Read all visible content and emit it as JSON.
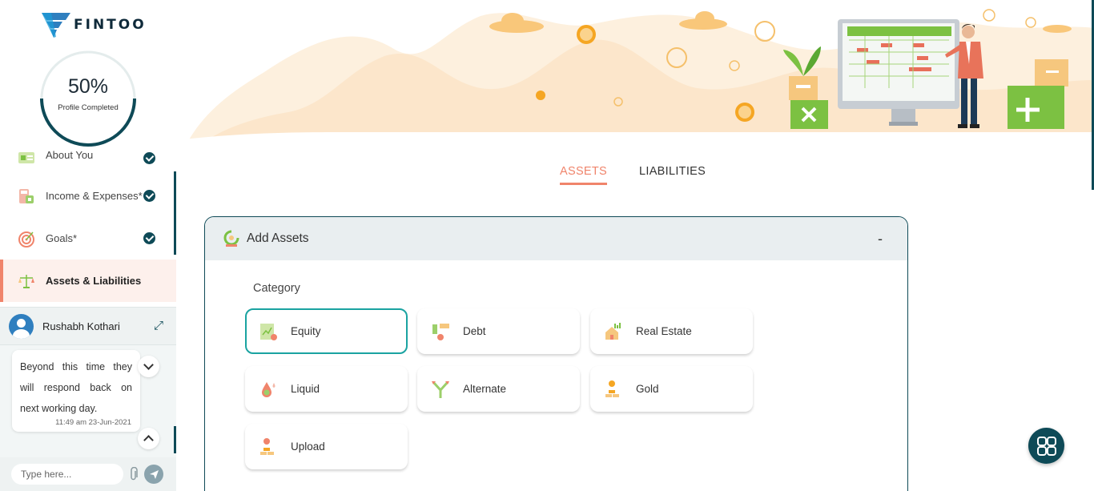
{
  "brand": {
    "name": "FINTOO"
  },
  "profile": {
    "percent": "50%",
    "label": "Profile Completed"
  },
  "nav": {
    "items": [
      {
        "label": "About You",
        "completed": true
      },
      {
        "label": "Income & Expenses*",
        "completed": true
      },
      {
        "label": "Goals*",
        "completed": true
      },
      {
        "label": "Assets & Liabilities",
        "active": true
      }
    ]
  },
  "chat": {
    "agent_name": "Rushabh Kothari",
    "message": "Beyond this time they will respond back on next working day.",
    "timestamp": "11:49 am 23-Jun-2021",
    "input_placeholder": "Type here..."
  },
  "tabs": [
    {
      "label": "ASSETS",
      "active": true
    },
    {
      "label": "LIABILITIES",
      "active": false
    }
  ],
  "card": {
    "title": "Add Assets",
    "collapse_symbol": "-",
    "category_label": "Category",
    "categories": [
      {
        "label": "Equity",
        "selected": true
      },
      {
        "label": "Debt"
      },
      {
        "label": "Real Estate"
      },
      {
        "label": "Liquid"
      },
      {
        "label": "Alternate"
      },
      {
        "label": "Gold"
      },
      {
        "label": "Upload"
      }
    ]
  },
  "colors": {
    "accent": "#f0846b",
    "primary": "#0e4a57",
    "teal": "#1aa3a1",
    "banner_bg": "#fdf0de"
  }
}
